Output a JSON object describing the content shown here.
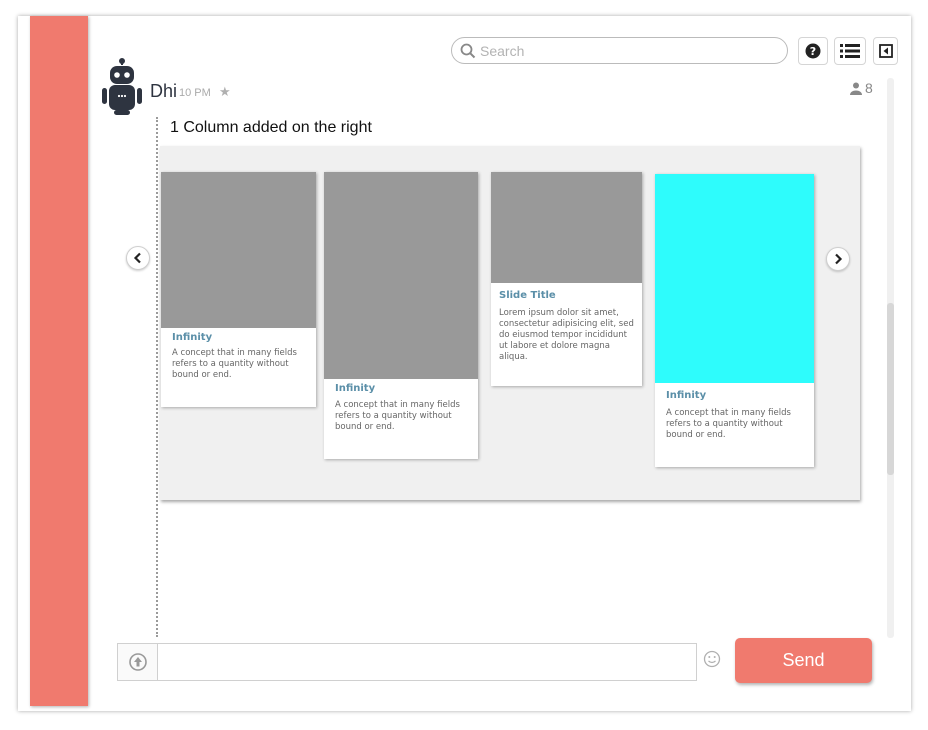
{
  "colors": {
    "accent": "#f07a6e",
    "card_image": "#999999",
    "card_image_highlight": "#2efcfc",
    "card_title": "#5b8fa8"
  },
  "search": {
    "placeholder": "Search",
    "value": ""
  },
  "toolbar": {
    "icons": [
      "help-icon",
      "list-icon",
      "collapse-panel-icon"
    ]
  },
  "message": {
    "sender": "Dhi",
    "time": "10 PM",
    "member_count": "8",
    "text": "1 Column added on the right"
  },
  "carousel": {
    "cards": [
      {
        "title": "Infinity",
        "description": "A concept that in many fields refers to a quantity without bound or end.",
        "image": "gray"
      },
      {
        "title": "Infinity",
        "description": "A concept that in many fields refers to a quantity without bound or end.",
        "image": "gray"
      },
      {
        "title": "Slide Title",
        "description": "Lorem ipsum dolor sit amet, consectetur adipisicing elit, sed do eiusmod tempor incididunt ut labore et dolore magna aliqua.",
        "image": "gray"
      },
      {
        "title": "Infinity",
        "description": "A concept that in many fields refers to a quantity without bound or end.",
        "image": "cyan"
      }
    ]
  },
  "composer": {
    "placeholder": "",
    "value": ""
  },
  "send_label": "Send"
}
